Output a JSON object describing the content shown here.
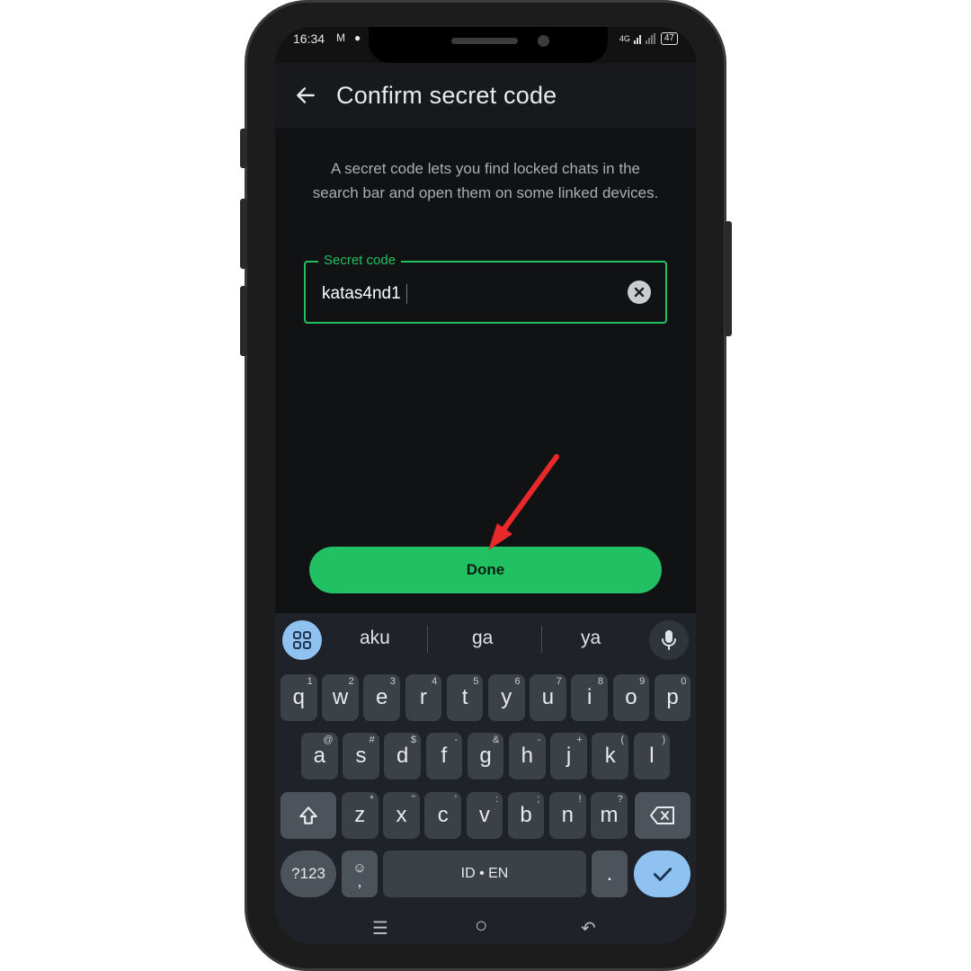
{
  "status_bar": {
    "time": "16:34",
    "icon_a": "mail-icon",
    "icon_b": "chat-icon",
    "network": "4G",
    "battery": "47"
  },
  "app_bar": {
    "back_icon": "arrow-left-icon",
    "title": "Confirm secret code"
  },
  "content": {
    "description": "A secret code lets you find locked chats in the search bar and open them on some linked devices.",
    "field": {
      "label": "Secret code",
      "value": "katas4nd1",
      "clear_icon": "clear-icon"
    },
    "done_label": "Done"
  },
  "keyboard": {
    "suggestions": [
      "aku",
      "ga",
      "ya"
    ],
    "row1": [
      {
        "k": "q",
        "h": "1"
      },
      {
        "k": "w",
        "h": "2"
      },
      {
        "k": "e",
        "h": "3"
      },
      {
        "k": "r",
        "h": "4"
      },
      {
        "k": "t",
        "h": "5"
      },
      {
        "k": "y",
        "h": "6"
      },
      {
        "k": "u",
        "h": "7"
      },
      {
        "k": "i",
        "h": "8"
      },
      {
        "k": "o",
        "h": "9"
      },
      {
        "k": "p",
        "h": "0"
      }
    ],
    "row2": [
      {
        "k": "a",
        "h": "@"
      },
      {
        "k": "s",
        "h": "#"
      },
      {
        "k": "d",
        "h": "$"
      },
      {
        "k": "f",
        "h": "-"
      },
      {
        "k": "g",
        "h": "&"
      },
      {
        "k": "h",
        "h": "-"
      },
      {
        "k": "j",
        "h": "+"
      },
      {
        "k": "k",
        "h": "("
      },
      {
        "k": "l",
        "h": ")"
      }
    ],
    "row3": [
      {
        "k": "z",
        "h": "*"
      },
      {
        "k": "x",
        "h": "\""
      },
      {
        "k": "c",
        "h": "'"
      },
      {
        "k": "v",
        "h": ":"
      },
      {
        "k": "b",
        "h": ";"
      },
      {
        "k": "n",
        "h": "!"
      },
      {
        "k": "m",
        "h": "?"
      }
    ],
    "symbols_label": "?123",
    "emoji_comma": ",",
    "space_label": "ID • EN",
    "period": "."
  },
  "nav_bar": {
    "recent_glyph": "☰",
    "home_glyph": "○",
    "back_glyph": "↶"
  },
  "colors": {
    "accent": "#21c063",
    "arrow": "#e8282b",
    "keyboard_bg": "#1f2329",
    "enter_key": "#8fc2f0"
  }
}
